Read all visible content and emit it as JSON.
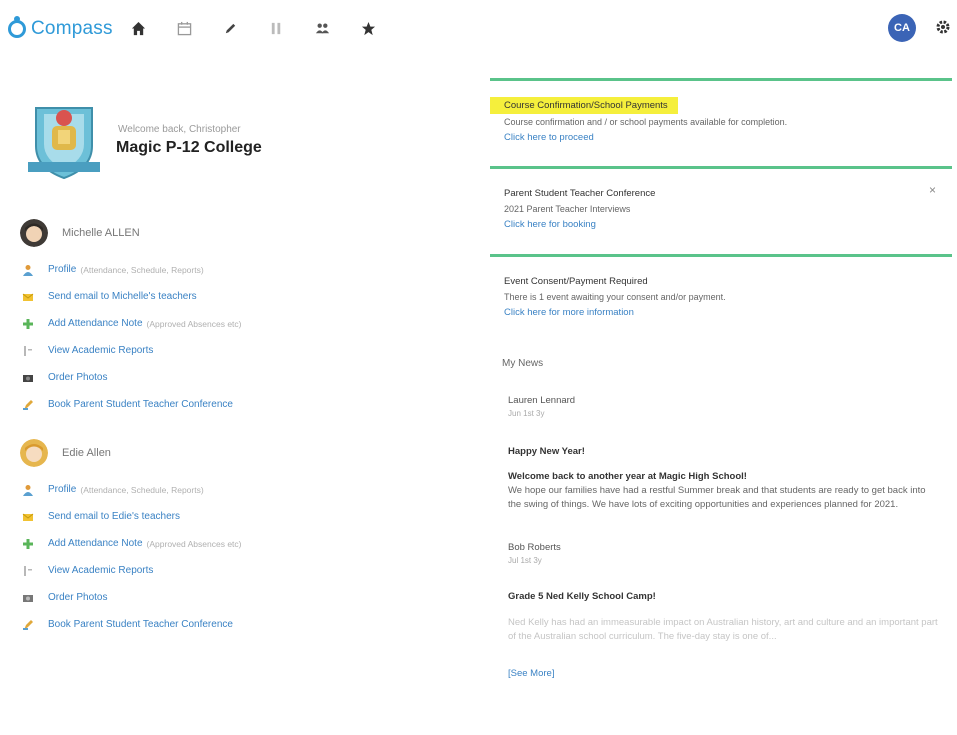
{
  "app": {
    "name": "Compass",
    "user_initials": "CA",
    "nav": [
      "home-icon",
      "calendar-icon",
      "pencil-icon",
      "grid-icon",
      "people-icon",
      "star-icon"
    ]
  },
  "school": {
    "welcome": "Welcome back, Christopher",
    "name": "Magic P-12 College"
  },
  "students": [
    {
      "name": "Michelle ALLEN",
      "actions": [
        {
          "icon": "profile-icon",
          "label": "Profile",
          "sub": "(Attendance, Schedule, Reports)"
        },
        {
          "icon": "email-icon",
          "label": "Send email to Michelle's teachers",
          "sub": ""
        },
        {
          "icon": "plus-icon",
          "label": "Add Attendance Note",
          "sub": "(Approved Absences etc)"
        },
        {
          "icon": "report-icon",
          "label": "View Academic Reports",
          "sub": ""
        },
        {
          "icon": "camera-icon",
          "label": "Order Photos",
          "sub": ""
        },
        {
          "icon": "conference-icon",
          "label": "Book Parent Student Teacher Conference",
          "sub": ""
        }
      ]
    },
    {
      "name": "Edie Allen",
      "actions": [
        {
          "icon": "profile-icon",
          "label": "Profile",
          "sub": "(Attendance, Schedule, Reports)"
        },
        {
          "icon": "email-icon",
          "label": "Send email to Edie's teachers",
          "sub": ""
        },
        {
          "icon": "plus-icon",
          "label": "Add Attendance Note",
          "sub": "(Approved Absences etc)"
        },
        {
          "icon": "report-icon",
          "label": "View Academic Reports",
          "sub": ""
        },
        {
          "icon": "camera-icon",
          "label": "Order Photos",
          "sub": ""
        },
        {
          "icon": "conference-icon",
          "label": "Book Parent Student Teacher Conference",
          "sub": ""
        }
      ]
    }
  ],
  "alerts": [
    {
      "title": "Course Confirmation/School Payments",
      "desc": "Course confirmation and / or school payments available for completion.",
      "link": "Click here to proceed"
    },
    {
      "title": "Parent Student Teacher Conference",
      "desc": "2021 Parent Teacher Interviews",
      "link": "Click here for booking",
      "close": "×"
    },
    {
      "title": "Event Consent/Payment Required",
      "desc": "There is 1 event awaiting your consent and/or payment.",
      "link": "Click here for more information"
    }
  ],
  "news": {
    "header": "My News",
    "items": [
      {
        "author": "Lauren Lennard",
        "time": "Jun 1st 3y",
        "title": "Happy New Year!",
        "subtitle": "Welcome back to another year at Magic High School!",
        "body": "We hope our families have had a restful Summer break and that students are ready to get back into the swing of things. We have lots of exciting opportunities and experiences planned for 2021."
      },
      {
        "author": "Bob Roberts",
        "time": "Jul 1st 3y",
        "title": "Grade 5 Ned Kelly School Camp!",
        "body": "Ned Kelly has had an immeasurable impact on Australian history, art and culture and an important part of the Australian school curriculum. The five-day stay is one of..."
      }
    ],
    "see_more": "[See More]"
  },
  "colors": {
    "accent": "#2f9ad8",
    "link": "#3a82c4",
    "alert_border": "#5ac38a",
    "highlight": "#f5ef3c",
    "avatar_bg": "#3b64b6"
  }
}
